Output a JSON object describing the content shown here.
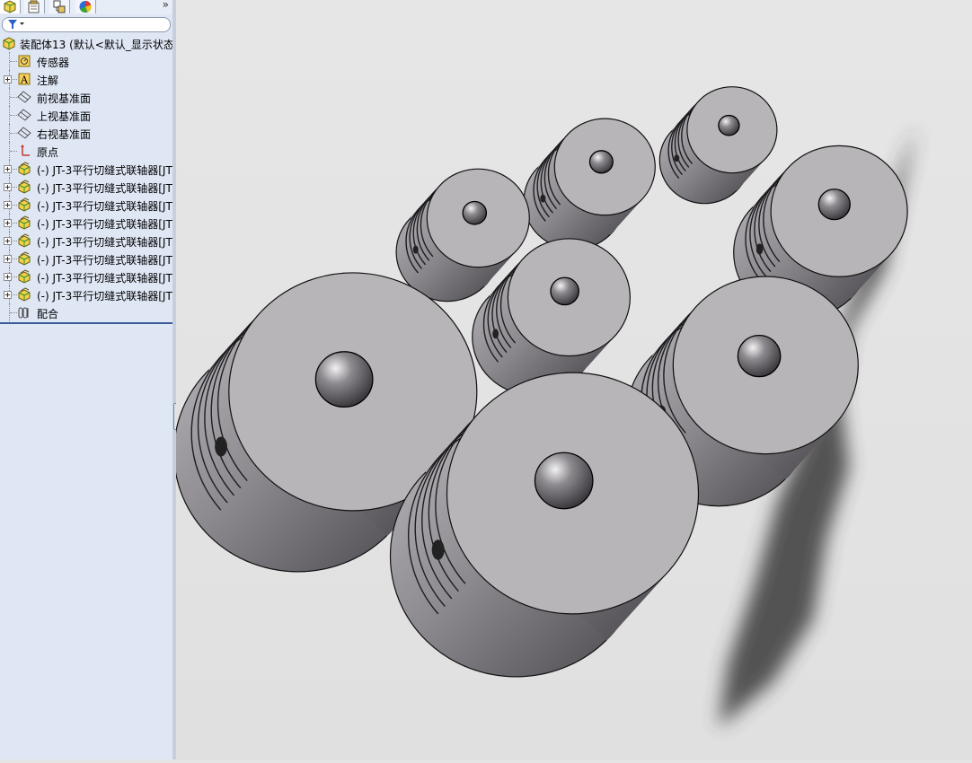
{
  "panel_tabs": [
    {
      "name": "feature-manager-tab",
      "icon": "feature-tree-icon"
    },
    {
      "name": "property-manager-tab",
      "icon": "property-icon"
    },
    {
      "name": "configuration-manager-tab",
      "icon": "configuration-icon"
    },
    {
      "name": "display-manager-tab",
      "icon": "appearance-icon"
    }
  ],
  "panel_expand": "»",
  "tree": {
    "root": "装配体13 (默认<默认_显示状态",
    "items": [
      {
        "label": "传感器",
        "icon": "sensor-icon"
      },
      {
        "label": "注解",
        "icon": "annotation-icon"
      },
      {
        "label": "前视基准面",
        "icon": "plane-icon"
      },
      {
        "label": "上视基准面",
        "icon": "plane-icon"
      },
      {
        "label": "右视基准面",
        "icon": "plane-icon"
      },
      {
        "label": "原点",
        "icon": "origin-icon"
      },
      {
        "label": "(-) JT-3平行切缝式联轴器[JT",
        "icon": "part-icon"
      },
      {
        "label": "(-) JT-3平行切缝式联轴器[JT",
        "icon": "part-icon"
      },
      {
        "label": "(-) JT-3平行切缝式联轴器[JT",
        "icon": "part-icon"
      },
      {
        "label": "(-) JT-3平行切缝式联轴器[JT",
        "icon": "part-icon"
      },
      {
        "label": "(-) JT-3平行切缝式联轴器[JT",
        "icon": "part-icon"
      },
      {
        "label": "(-) JT-3平行切缝式联轴器[JT",
        "icon": "part-icon"
      },
      {
        "label": "(-) JT-3平行切缝式联轴器[JT",
        "icon": "part-icon"
      },
      {
        "label": "(-) JT-3平行切缝式联轴器[JT",
        "icon": "part-icon"
      },
      {
        "label": "配合",
        "icon": "mates-icon"
      }
    ]
  },
  "colors": {
    "panel_bg": "#dfe7f5",
    "viewport_bg": "#e4e4e4",
    "part_face": "#b8b5b8",
    "part_side": "#8a878c",
    "shadow": "#3a3a3a"
  }
}
